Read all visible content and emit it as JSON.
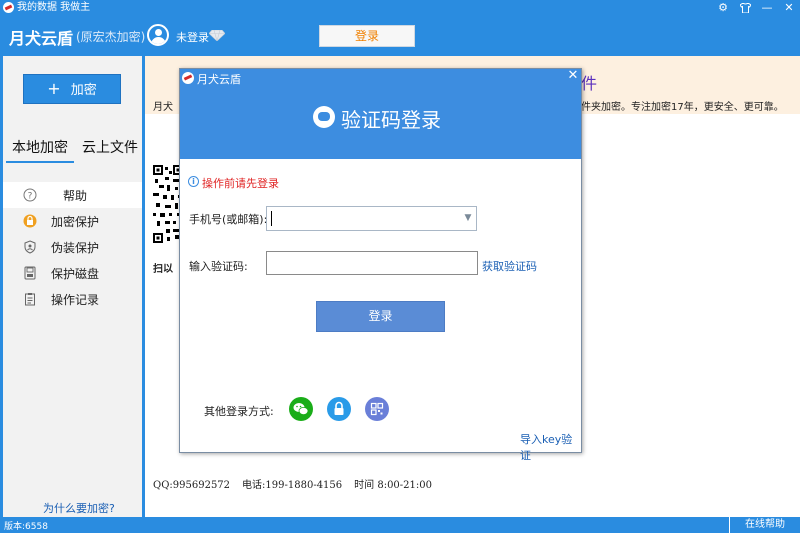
{
  "window": {
    "title": "我的数据 我做主",
    "controls": [
      "gear-icon",
      "shirt-icon",
      "minimize-icon",
      "maximize-icon",
      "close-icon"
    ]
  },
  "header": {
    "brand": "月犬云盾",
    "brand_sub": "(原宏杰加密)",
    "login_status": "未登录",
    "login_button": "登录"
  },
  "sidebar": {
    "encrypt_button": "加密",
    "tabs": [
      {
        "label": "本地加密",
        "active": true
      },
      {
        "label": "云上文件",
        "active": false
      }
    ],
    "menu": [
      {
        "label": "帮助",
        "icon": "question-icon",
        "selected": true
      },
      {
        "label": "加密保护",
        "icon": "lock-icon",
        "selected": false
      },
      {
        "label": "伪装保护",
        "icon": "shield-icon",
        "selected": false
      },
      {
        "label": "保护磁盘",
        "icon": "disk-icon",
        "selected": false
      },
      {
        "label": "操作记录",
        "icon": "clipboard-icon",
        "selected": false
      }
    ],
    "why_link": "为什么要加密?"
  },
  "main": {
    "banner_title": "件",
    "banner_left": "月犬",
    "banner_right": "件夹加密。专注加密17年，更安全、更可靠。",
    "scan_text": "扫以",
    "contact": {
      "qq": "QQ:995692572",
      "phone": "电话:199-1880-4156",
      "hours": "时间  8:00-21:00"
    }
  },
  "dialog": {
    "title": "月犬云盾",
    "heading": "验证码登录",
    "warning": "操作前请先登录",
    "phone_label": "手机号(或邮箱):",
    "phone_value": "",
    "code_label": "输入验证码:",
    "code_value": "",
    "get_code": "获取验证码",
    "submit": "登录",
    "other_label": "其他登录方式:",
    "alt_methods": [
      {
        "icon": "wechat-icon",
        "color": "#1aad19"
      },
      {
        "icon": "lock-icon",
        "color": "#2a9be8"
      },
      {
        "icon": "qrcode-icon",
        "color": "#6a7fd8"
      }
    ],
    "import_key": "导入key验证"
  },
  "statusbar": {
    "version": "版本:6558",
    "help": "在线帮助"
  },
  "colors": {
    "brand_blue": "#2a8ce0",
    "dialog_blue": "#3d8de0",
    "button_blue": "#5a8cd6",
    "warning_red": "#e02424",
    "link_blue": "#1a5fb4",
    "banner_bg": "#fdf0e0"
  }
}
